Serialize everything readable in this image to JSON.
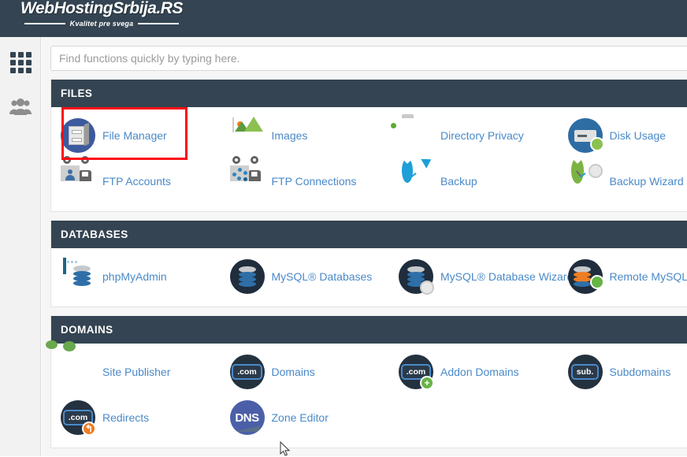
{
  "header": {
    "logo_title": "WebHostingSrbija.RS",
    "logo_tagline": "Kvalitet pre svega",
    "background_color": "#344452"
  },
  "sidebar": {
    "items": [
      {
        "name": "apps-grid",
        "icon": "grid-icon",
        "label": ""
      },
      {
        "name": "user-manager",
        "icon": "people-icon",
        "label": ""
      }
    ]
  },
  "search": {
    "placeholder": "Find functions quickly by typing here.",
    "value": ""
  },
  "highlight": {
    "target": "File Manager",
    "color": "#fb0b14"
  },
  "accent_link_color": "#4a89c8",
  "sections": [
    {
      "title": "FILES",
      "items": [
        {
          "label": "File Manager",
          "icon": "file-cabinet-icon"
        },
        {
          "label": "Images",
          "icon": "images-icon"
        },
        {
          "label": "Directory Privacy",
          "icon": "folder-eye-icon"
        },
        {
          "label": "Disk Usage",
          "icon": "disk-usage-icon"
        },
        {
          "label": "FTP Accounts",
          "icon": "ftp-accounts-truck-icon"
        },
        {
          "label": "FTP Connections",
          "icon": "ftp-connections-truck-icon"
        },
        {
          "label": "Backup",
          "icon": "backup-clock-icon"
        },
        {
          "label": "Backup Wizard",
          "icon": "backup-wizard-icon"
        }
      ]
    },
    {
      "title": "DATABASES",
      "items": [
        {
          "label": "phpMyAdmin",
          "icon": "phpmyadmin-icon"
        },
        {
          "label": "MySQL® Databases",
          "icon": "mysql-database-icon"
        },
        {
          "label": "MySQL® Database Wizard",
          "icon": "mysql-wizard-icon"
        },
        {
          "label": "Remote MySQL®",
          "icon": "remote-mysql-icon"
        }
      ]
    },
    {
      "title": "DOMAINS",
      "items": [
        {
          "label": "Site Publisher",
          "icon": "site-publisher-icon"
        },
        {
          "label": "Domains",
          "icon": "domains-com-icon"
        },
        {
          "label": "Addon Domains",
          "icon": "addon-domains-icon"
        },
        {
          "label": "Subdomains",
          "icon": "subdomains-icon"
        },
        {
          "label": "Redirects",
          "icon": "redirects-icon"
        },
        {
          "label": "Zone Editor",
          "icon": "dns-zone-editor-icon"
        }
      ]
    }
  ],
  "icon_glyphs": {
    "domains_pill": ".com",
    "addon_pill": ".com",
    "subdomain_pill": "sub.",
    "redirects_pill": ".com",
    "dns_text": "DNS",
    "addon_badge": "+",
    "redirect_badge": "↰"
  }
}
